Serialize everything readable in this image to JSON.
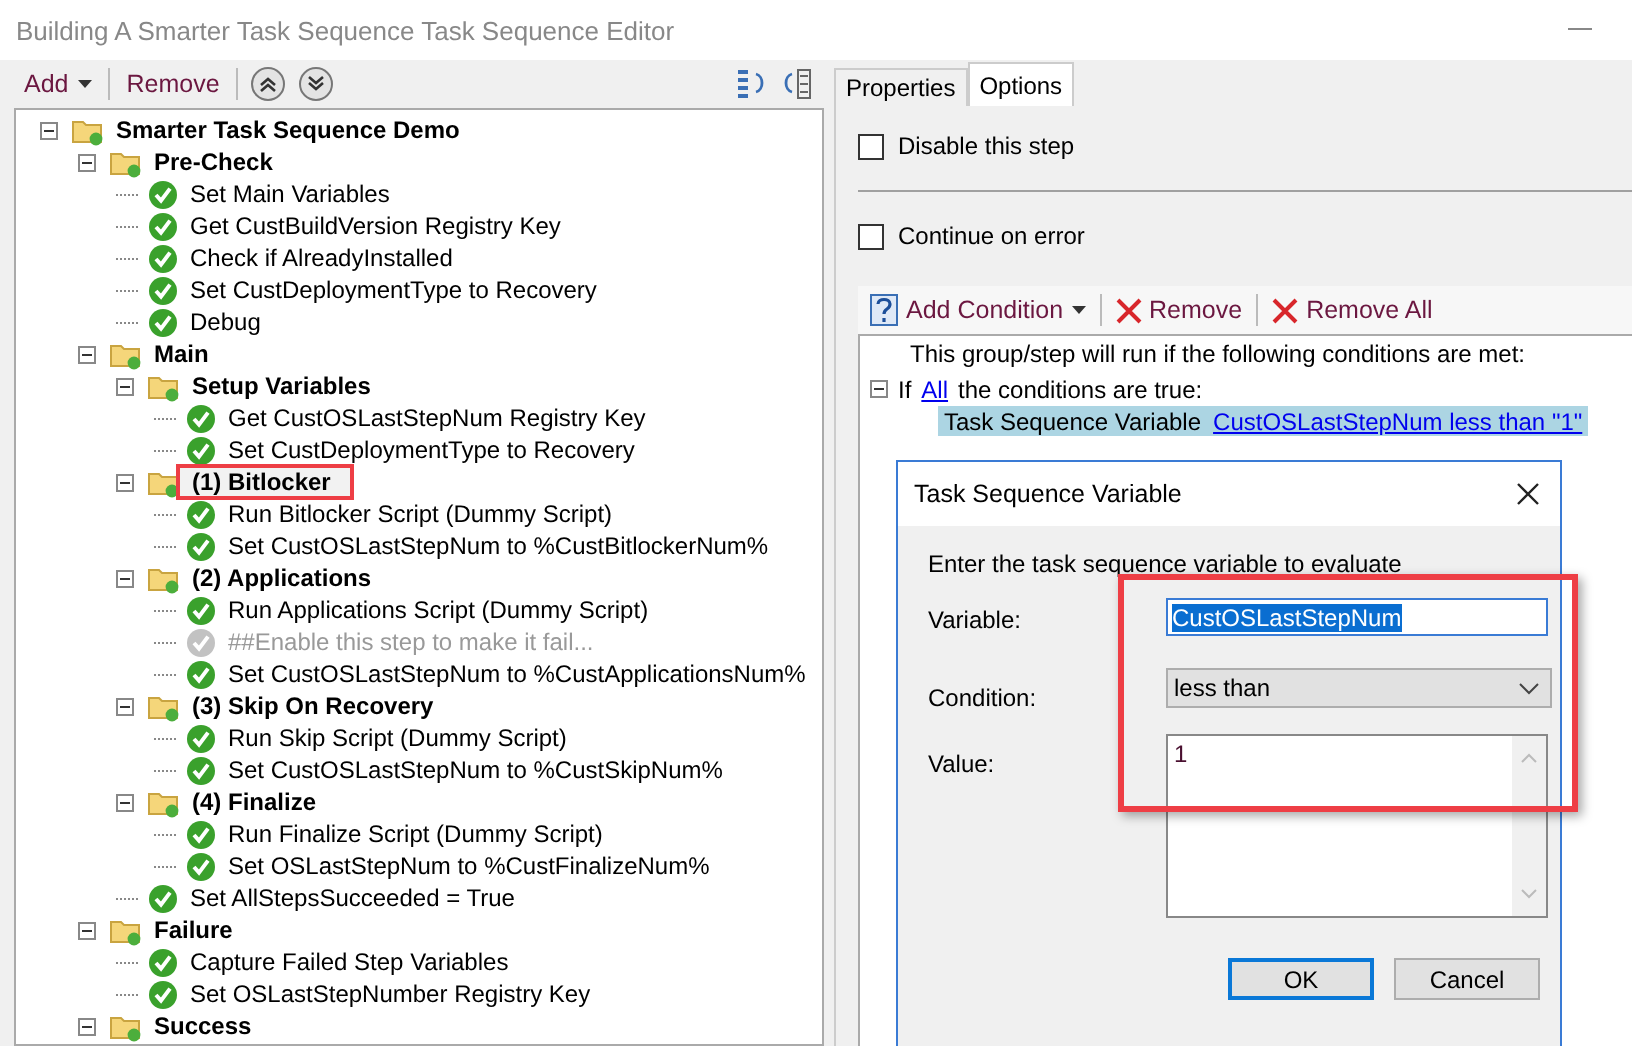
{
  "window": {
    "title": "Building A Smarter Task Sequence Task Sequence Editor"
  },
  "toolbar": {
    "add": "Add",
    "remove": "Remove"
  },
  "tree": [
    {
      "name": "Smarter Task Sequence Demo",
      "kind": "group",
      "expanded": true,
      "highlighted": false,
      "children": [
        {
          "name": "Pre-Check",
          "kind": "group",
          "expanded": true,
          "highlighted": false,
          "children": [
            {
              "name": "Set Main Variables",
              "kind": "step",
              "disabled": false,
              "highlighted": false
            },
            {
              "name": "Get CustBuildVersion Registry Key",
              "kind": "step",
              "disabled": false,
              "highlighted": false
            },
            {
              "name": "Check if AlreadyInstalled",
              "kind": "step",
              "disabled": false,
              "highlighted": false
            },
            {
              "name": "Set CustDeploymentType to Recovery",
              "kind": "step",
              "disabled": false,
              "highlighted": false
            },
            {
              "name": "Debug",
              "kind": "step",
              "disabled": false,
              "highlighted": false
            }
          ]
        },
        {
          "name": "Main",
          "kind": "group",
          "expanded": true,
          "highlighted": false,
          "children": [
            {
              "name": "Setup Variables",
              "kind": "group",
              "expanded": true,
              "highlighted": false,
              "children": [
                {
                  "name": "Get CustOSLastStepNum Registry Key",
                  "kind": "step",
                  "disabled": false,
                  "highlighted": false
                },
                {
                  "name": "Set CustDeploymentType to Recovery",
                  "kind": "step",
                  "disabled": false,
                  "highlighted": false
                }
              ]
            },
            {
              "name": "(1) Bitlocker",
              "kind": "group",
              "expanded": true,
              "highlighted": true,
              "children": [
                {
                  "name": "Run Bitlocker Script (Dummy Script)",
                  "kind": "step",
                  "disabled": false,
                  "highlighted": false
                },
                {
                  "name": "Set CustOSLastStepNum to %CustBitlockerNum%",
                  "kind": "step",
                  "disabled": false,
                  "highlighted": false
                }
              ]
            },
            {
              "name": "(2) Applications",
              "kind": "group",
              "expanded": true,
              "highlighted": false,
              "children": [
                {
                  "name": "Run Applications Script (Dummy Script)",
                  "kind": "step",
                  "disabled": false,
                  "highlighted": false
                },
                {
                  "name": "##Enable this step to make it fail...",
                  "kind": "step",
                  "disabled": true,
                  "highlighted": false
                },
                {
                  "name": "Set CustOSLastStepNum to %CustApplicationsNum%",
                  "kind": "step",
                  "disabled": false,
                  "highlighted": false
                }
              ]
            },
            {
              "name": "(3) Skip On Recovery",
              "kind": "group",
              "expanded": true,
              "highlighted": false,
              "children": [
                {
                  "name": "Run Skip Script (Dummy Script)",
                  "kind": "step",
                  "disabled": false,
                  "highlighted": false
                },
                {
                  "name": "Set CustOSLastStepNum to %CustSkipNum%",
                  "kind": "step",
                  "disabled": false,
                  "highlighted": false
                }
              ]
            },
            {
              "name": "(4) Finalize",
              "kind": "group",
              "expanded": true,
              "highlighted": false,
              "children": [
                {
                  "name": "Run Finalize Script (Dummy Script)",
                  "kind": "step",
                  "disabled": false,
                  "highlighted": false
                },
                {
                  "name": "Set OSLastStepNum to %CustFinalizeNum%",
                  "kind": "step",
                  "disabled": false,
                  "highlighted": false
                }
              ]
            },
            {
              "name": "Set AllStepsSucceeded = True",
              "kind": "step",
              "disabled": false,
              "highlighted": false
            }
          ]
        },
        {
          "name": "Failure",
          "kind": "group",
          "expanded": true,
          "highlighted": false,
          "children": [
            {
              "name": "Capture Failed Step Variables",
              "kind": "step",
              "disabled": false,
              "highlighted": false
            },
            {
              "name": "Set OSLastStepNumber Registry Key",
              "kind": "step",
              "disabled": false,
              "highlighted": false
            }
          ]
        },
        {
          "name": "Success",
          "kind": "group",
          "expanded": true,
          "highlighted": false
        }
      ]
    }
  ],
  "tabs": [
    {
      "label": "Properties",
      "selected": false
    },
    {
      "label": "Options",
      "selected": true
    }
  ],
  "options": [
    {
      "label": "Disable this step",
      "checked": false
    },
    {
      "label": "Continue on error",
      "checked": false
    }
  ],
  "condition_toolbar": {
    "add": "Add Condition",
    "remove": "Remove",
    "remove_all": "Remove All"
  },
  "conditions": {
    "intro": "This group/step will run if the following conditions are met:",
    "if_prefix": "If",
    "match": "All",
    "if_suffix": "the conditions are true:",
    "items": [
      {
        "type": "Task Sequence Variable",
        "detail": "CustOSLastStepNum less than \"1\"",
        "selected": true
      }
    ]
  },
  "dialog": {
    "title": "Task Sequence Variable",
    "prompt": "Enter the task sequence variable to evaluate",
    "highlighted": true,
    "fields": [
      {
        "label": "Variable:",
        "kind": "text",
        "value": "CustOSLastStepNum"
      },
      {
        "label": "Condition:",
        "kind": "select",
        "value": "less than"
      },
      {
        "label": "Value:",
        "kind": "textarea",
        "value": "1"
      }
    ],
    "buttons": [
      {
        "label": "OK",
        "default": true
      },
      {
        "label": "Cancel",
        "default": false
      }
    ]
  }
}
